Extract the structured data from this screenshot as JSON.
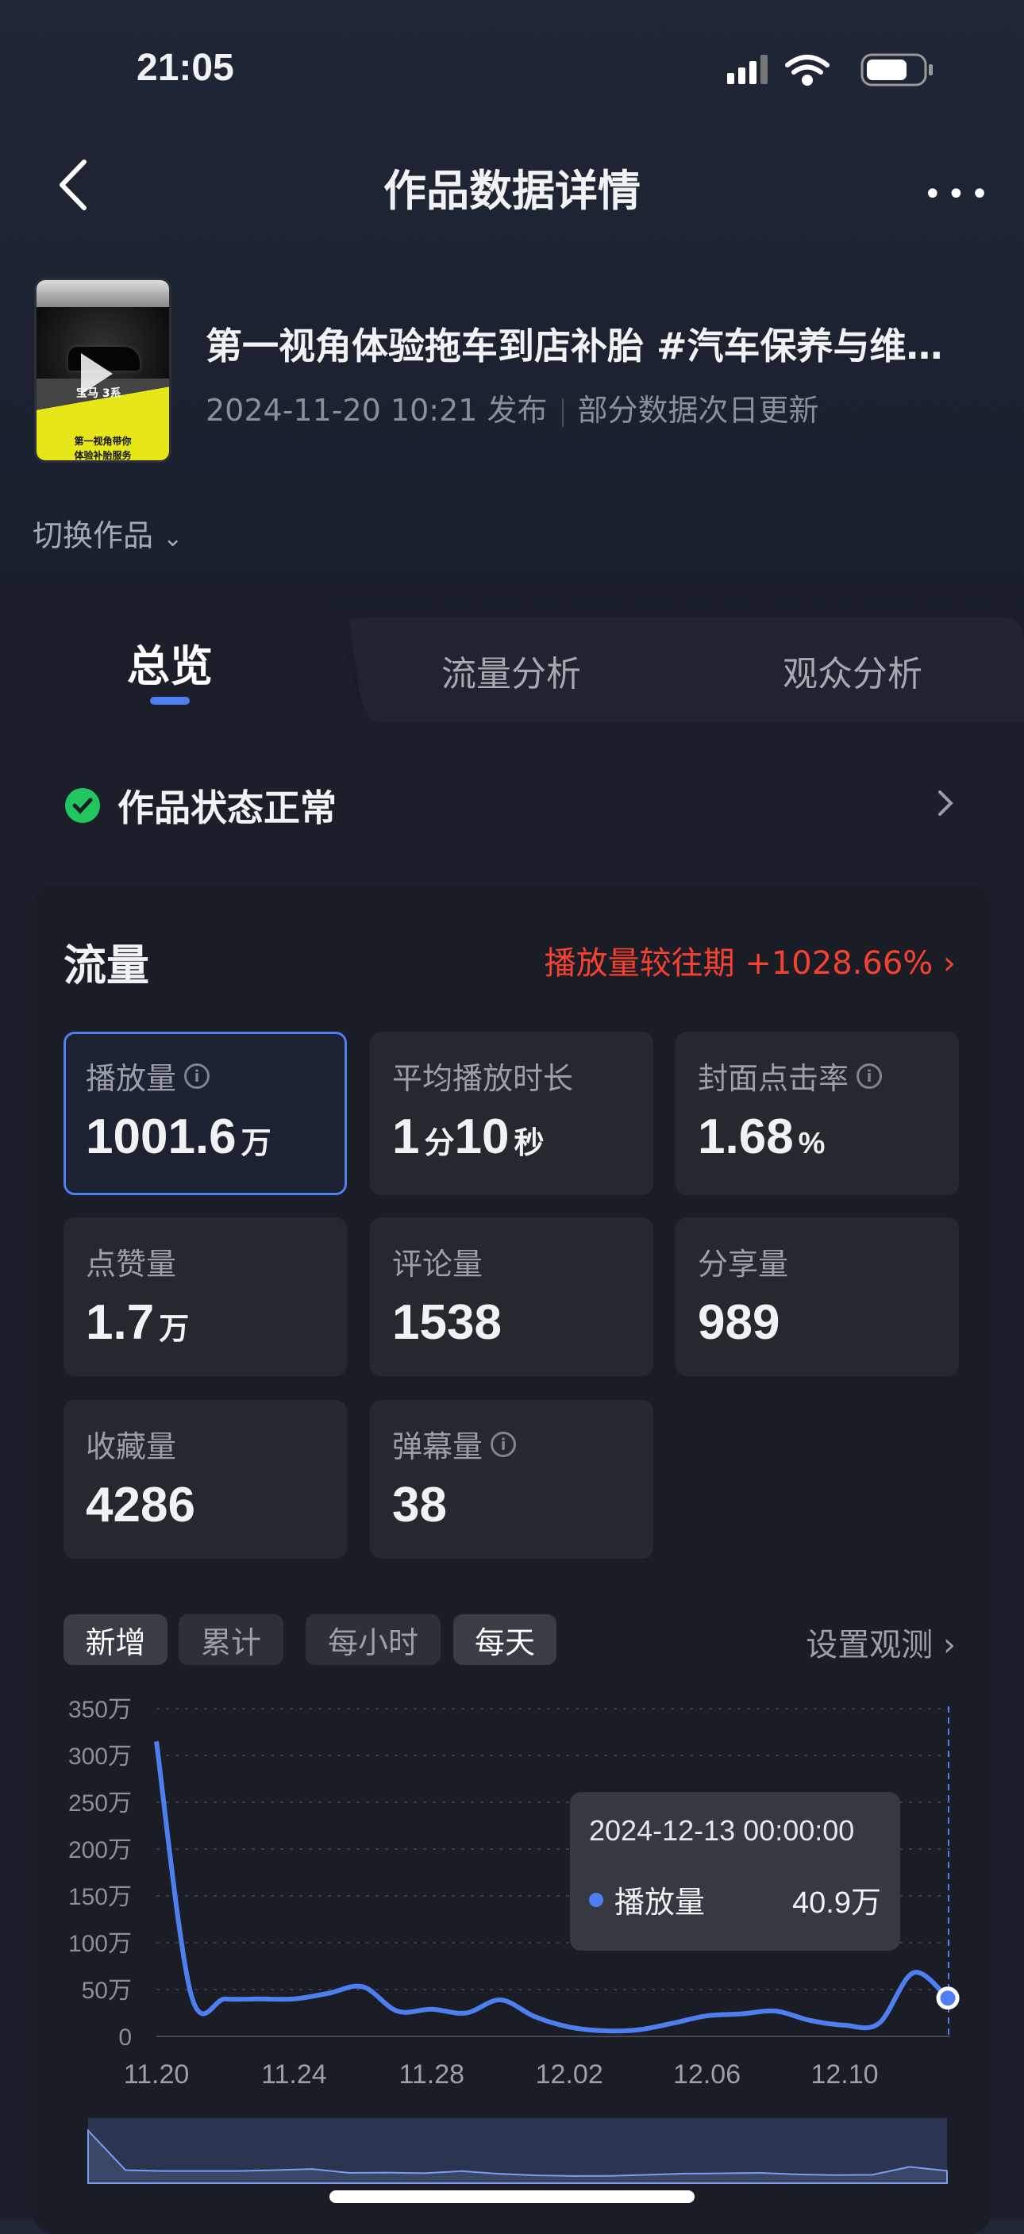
{
  "status_bar": {
    "time": "21:05"
  },
  "nav": {
    "title": "作品数据详情",
    "back_icon": "chevron-left-icon",
    "more_icon": "more-dots-icon"
  },
  "video": {
    "title": "第一视角体验拖车到店补胎 #汽车保养与维…",
    "published": "2024-11-20 10:21 发布",
    "note": "部分数据次日更新",
    "thumb_text": [
      "宝马 3系",
      "第一视角带你",
      "体验补胎服务"
    ]
  },
  "switch_label": "切换作品",
  "tabs": [
    {
      "label": "总览",
      "active": true
    },
    {
      "label": "流量分析"
    },
    {
      "label": "观众分析"
    }
  ],
  "work_status": "作品状态正常",
  "traffic": {
    "title": "流量",
    "comparison": "播放量较往期 +1028.66%",
    "metrics": [
      {
        "label": "播放量",
        "value": "1001.6",
        "unit": "万",
        "info": true,
        "selected": true
      },
      {
        "label": "平均播放时长",
        "value": "1",
        "unit": "分",
        "value2": "10",
        "unit2": "秒"
      },
      {
        "label": "封面点击率",
        "value": "1.68",
        "unit": "%",
        "info": true
      },
      {
        "label": "点赞量",
        "value": "1.7",
        "unit": "万"
      },
      {
        "label": "评论量",
        "value": "1538"
      },
      {
        "label": "分享量",
        "value": "989"
      },
      {
        "label": "收藏量",
        "value": "4286"
      },
      {
        "label": "弹幕量",
        "value": "38",
        "info": true
      }
    ],
    "filters": [
      {
        "label": "新增",
        "active": true
      },
      {
        "label": "累计"
      },
      {
        "label": "每小时"
      },
      {
        "label": "每天",
        "active": true
      }
    ],
    "observe": "设置观测"
  },
  "colors": {
    "accent": "#4f7ef0",
    "increase": "#f5412f"
  },
  "chart_data": {
    "type": "line",
    "series": [
      {
        "name": "播放量",
        "values": [
          315,
          46,
          40,
          40,
          40,
          46,
          53,
          27,
          29,
          25,
          39,
          21,
          10,
          6,
          7,
          14,
          22,
          24,
          27,
          17,
          12,
          14,
          68,
          40.9
        ]
      }
    ],
    "x": [
      "11.20",
      "11.21",
      "11.22",
      "11.23",
      "11.24",
      "11.25",
      "11.26",
      "11.27",
      "11.28",
      "11.29",
      "11.30",
      "12.01",
      "12.02",
      "12.03",
      "12.04",
      "12.05",
      "12.06",
      "12.07",
      "12.08",
      "12.09",
      "12.10",
      "12.11",
      "12.12",
      "12.13"
    ],
    "x_ticks": [
      "11.20",
      "11.24",
      "11.28",
      "12.02",
      "12.06",
      "12.10"
    ],
    "y_ticks": [
      "0",
      "50万",
      "100万",
      "150万",
      "200万",
      "250万",
      "300万",
      "350万"
    ],
    "ylim": [
      0,
      350
    ],
    "unit": "万",
    "grid": true,
    "tooltip": {
      "date": "2024-12-13 00:00:00",
      "series": "播放量",
      "value": "40.9万"
    }
  }
}
